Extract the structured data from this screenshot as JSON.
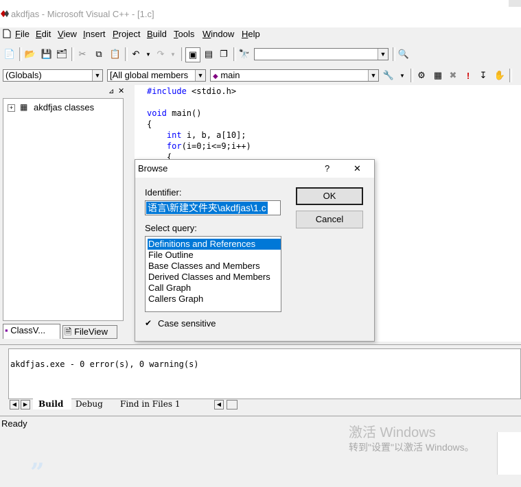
{
  "window": {
    "title": "akdfjas - Microsoft Visual C++ - [1.c]"
  },
  "menubar": {
    "items": [
      {
        "label": "File",
        "hotkey": "F"
      },
      {
        "label": "Edit",
        "hotkey": "E"
      },
      {
        "label": "View",
        "hotkey": "V"
      },
      {
        "label": "Insert",
        "hotkey": "I"
      },
      {
        "label": "Project",
        "hotkey": "P"
      },
      {
        "label": "Build",
        "hotkey": "B"
      },
      {
        "label": "Tools",
        "hotkey": "T"
      },
      {
        "label": "Window",
        "hotkey": "W"
      },
      {
        "label": "Help",
        "hotkey": "H"
      }
    ]
  },
  "toolbar": {
    "find_value": "",
    "globals_value": "(Globals)",
    "members_value": "[All global members",
    "function_value": "main"
  },
  "workspace": {
    "tree_root": "akdfjas classes",
    "tabs": {
      "classview": "ClassV...",
      "fileview": "FileView"
    }
  },
  "editor": {
    "lines": [
      "#include <stdio.h>",
      "",
      "void main()",
      "{",
      "    int i, b, a[10];",
      "    for(i=0;i<=9;i++)",
      "    {"
    ]
  },
  "dialog": {
    "title": "Browse",
    "help_glyph": "?",
    "close_glyph": "✕",
    "identifier_label": "Identifier:",
    "identifier_value": "语言\\新建文件夹\\akdfjas\\1.c",
    "select_query_label": "Select query:",
    "queries": [
      "Definitions and References",
      "File Outline",
      "Base Classes and Members",
      "Derived Classes and Members",
      "Call Graph",
      "Callers Graph"
    ],
    "selected_query_index": 0,
    "case_sensitive_label": "Case sensitive",
    "case_sensitive_checked": true,
    "ok_label": "OK",
    "cancel_label": "Cancel"
  },
  "output": {
    "text": "akdfjas.exe - 0 error(s), 0 warning(s)",
    "tabs": [
      "Build",
      "Debug",
      "Find in Files 1"
    ]
  },
  "statusbar": {
    "text": "Ready"
  },
  "watermark": {
    "line1": "激活 Windows",
    "line2": "转到\"设置\"以激活 Windows。"
  },
  "colors": {
    "selection": "#0078d7",
    "keyword": "#0000ff",
    "chrome": "#f0f0f0"
  }
}
